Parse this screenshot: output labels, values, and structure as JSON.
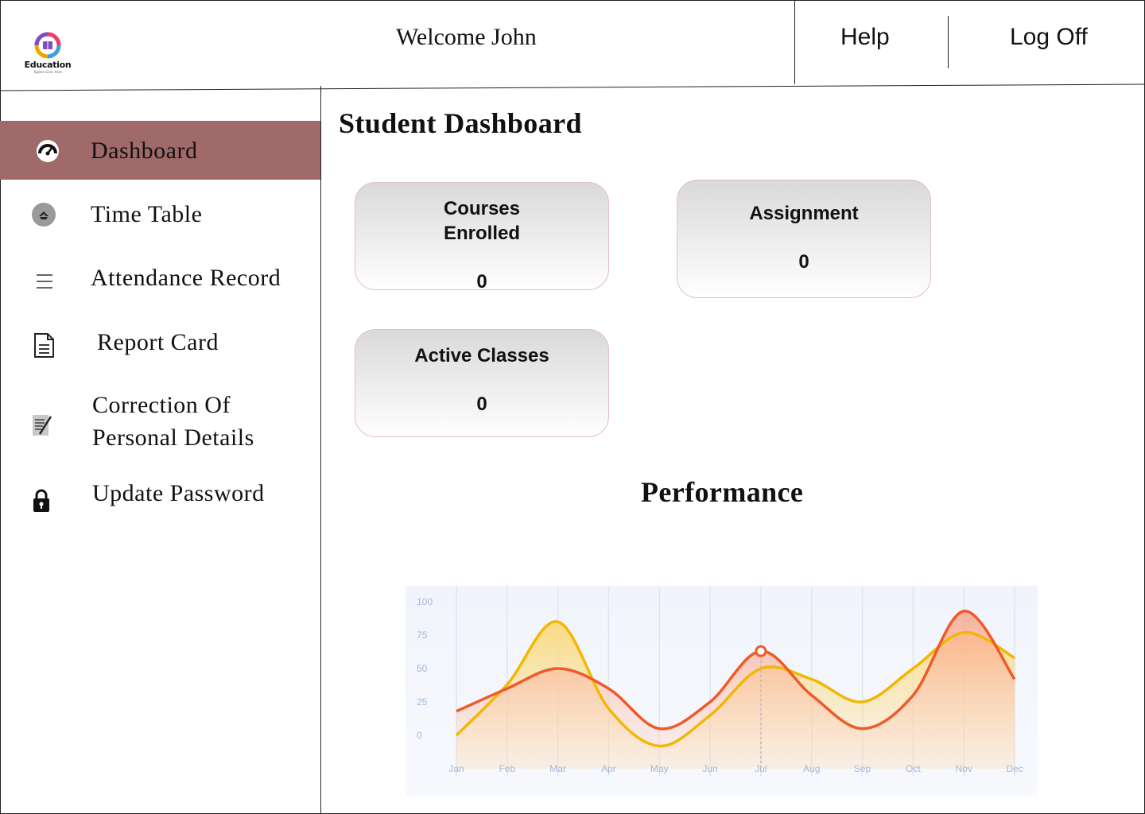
{
  "header": {
    "logo_text": "Education",
    "logo_tagline": "Tagline Goes Here",
    "welcome": "Welcome John",
    "help_label": "Help",
    "logoff_label": "Log Off"
  },
  "sidebar": {
    "items": [
      {
        "label": "Dashboard",
        "icon": "dashboard-gauge-icon",
        "active": true
      },
      {
        "label": "Time Table",
        "icon": "timetable-icon",
        "active": false
      },
      {
        "label": "Attendance Record",
        "icon": "menu-lines-icon",
        "active": false
      },
      {
        "label": "Report Card",
        "icon": "document-icon",
        "active": false
      },
      {
        "label": "Correction Of\nPersonal Details",
        "icon": "edit-document-icon",
        "active": false
      },
      {
        "label": "Update Password",
        "icon": "lock-icon",
        "active": false
      }
    ]
  },
  "main": {
    "title": "Student Dashboard",
    "cards": [
      {
        "title": "Courses\nEnrolled",
        "value": "0"
      },
      {
        "title": "Assignment",
        "value": "0"
      },
      {
        "title": "Active Classes",
        "value": "0"
      }
    ],
    "performance_title": "Performance"
  },
  "colors": {
    "sidebar_active": "#a0696a",
    "series_red": "#f05a2a",
    "series_yellow": "#f2b705"
  },
  "chart_data": {
    "type": "area",
    "categories": [
      "Jan",
      "Feb",
      "Mar",
      "Apr",
      "May",
      "Jun",
      "Jul",
      "Aug",
      "Sep",
      "Oct",
      "Nov",
      "Dec"
    ],
    "y_ticks": [
      "100",
      "75",
      "50",
      "25",
      "0"
    ],
    "ylim": [
      0,
      100
    ],
    "grid": true,
    "series": [
      {
        "values": [
          18,
          35,
          50,
          35,
          5,
          25,
          63,
          30,
          5,
          30,
          93,
          42
        ]
      },
      {
        "values": [
          0,
          38,
          85,
          20,
          -8,
          15,
          50,
          42,
          25,
          50,
          77,
          58
        ]
      }
    ],
    "highlight": {
      "category": "Jul",
      "value": 63
    }
  }
}
